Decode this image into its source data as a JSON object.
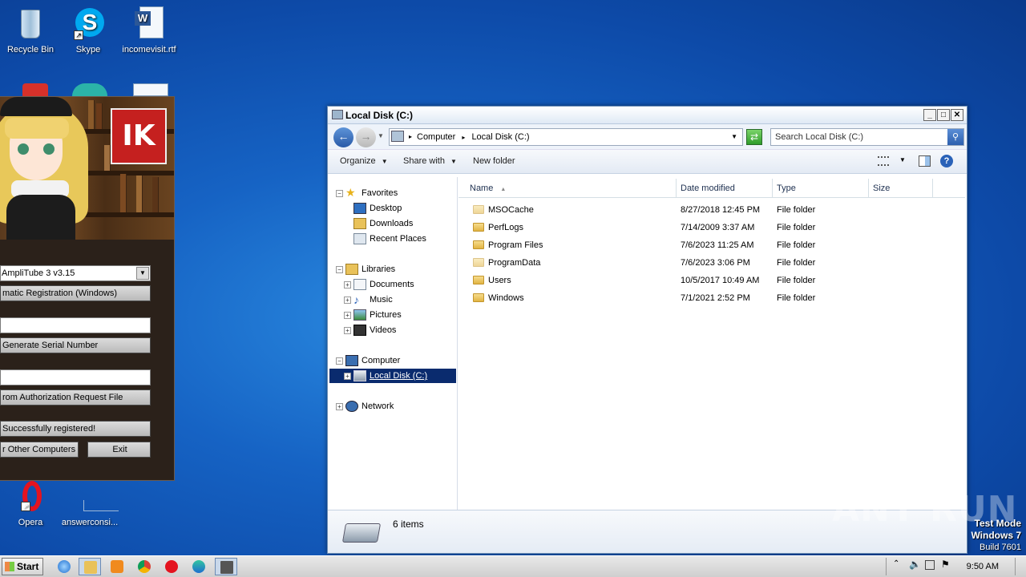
{
  "desktop": {
    "icons_top": [
      {
        "label": "Recycle Bin",
        "icon": "recycle-bin-icon"
      },
      {
        "label": "Skype",
        "icon": "skype-icon"
      },
      {
        "label": "incomevisit.rtf",
        "icon": "word-document-icon"
      }
    ],
    "icons_bottom": [
      {
        "label": "Opera",
        "icon": "opera-icon"
      },
      {
        "label": "answerconsi...",
        "icon": "file-icon"
      }
    ]
  },
  "keygen": {
    "logo_text": "IK",
    "product_select": "AmpliTube 3 v3.15",
    "btn_auto_reg": "matic Registration (Windows)",
    "btn_generate_serial": " Generate Serial Number",
    "btn_from_auth": "rom Authorization Request File",
    "status_text": " Successfully registered!",
    "btn_other_computers": "r Other Computers",
    "btn_exit": "Exit"
  },
  "explorer": {
    "title": "Local Disk (C:)",
    "address": {
      "crumbs": [
        "Computer",
        "Local Disk (C:)"
      ]
    },
    "search_placeholder": "Search Local Disk (C:)",
    "commands": {
      "organize": "Organize",
      "share_with": "Share with",
      "new_folder": "New folder"
    },
    "nav": {
      "favorites": "Favorites",
      "desktop": "Desktop",
      "downloads": "Downloads",
      "recent_places": "Recent Places",
      "libraries": "Libraries",
      "documents": "Documents",
      "music": "Music",
      "pictures": "Pictures",
      "videos": "Videos",
      "computer": "Computer",
      "local_disk": "Local Disk (C:)",
      "network": "Network"
    },
    "columns": {
      "name": "Name",
      "date": "Date modified",
      "type": "Type",
      "size": "Size"
    },
    "files": [
      {
        "name": "MSOCache",
        "date": "8/27/2018 12:45 PM",
        "type": "File folder"
      },
      {
        "name": "PerfLogs",
        "date": "7/14/2009 3:37 AM",
        "type": "File folder"
      },
      {
        "name": "Program Files",
        "date": "7/6/2023 11:25 AM",
        "type": "File folder"
      },
      {
        "name": "ProgramData",
        "date": "7/6/2023 3:06 PM",
        "type": "File folder"
      },
      {
        "name": "Users",
        "date": "10/5/2017 10:49 AM",
        "type": "File folder"
      },
      {
        "name": "Windows",
        "date": "7/1/2021 2:52 PM",
        "type": "File folder"
      }
    ],
    "status": "6 items"
  },
  "taskbar": {
    "start_label": "Start",
    "clock": "9:50 AM"
  },
  "overlay": {
    "watermark": "ANY RUN",
    "testmode_line1": "Test Mode",
    "testmode_line2": "Windows 7",
    "testmode_line3": "Build 7601"
  },
  "colors": {
    "selection": "#0a2b6e",
    "desktop": "#1663c4",
    "keygen_logo": "#c5201f"
  }
}
